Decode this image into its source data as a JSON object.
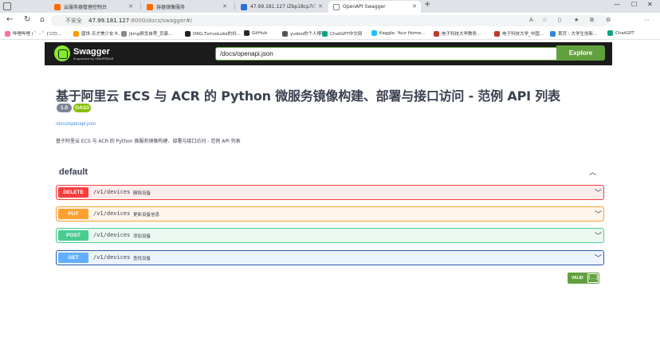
{
  "browser": {
    "tabs": [
      {
        "title": "云服务器管理控制台",
        "favicon_color": "#ff6a00",
        "active": false
      },
      {
        "title": "容器镜像服务",
        "favicon_color": "#ff6a00",
        "active": false
      },
      {
        "title": "47.99.181.127 iZbp18cp7r1h5ei0...",
        "favicon_color": "#2a6fdb",
        "active": false
      },
      {
        "title": "OpenAPI Swagger",
        "favicon_color": "#888888",
        "active": true
      }
    ],
    "new_tab_label": "+",
    "address": {
      "security_label": "不安全",
      "host": "47.99.181.127",
      "rest": ":8000/docs/swagger#/",
      "right_label": "A"
    },
    "bookmarks": [
      {
        "label": "哔哩哔哩 ( ゜- ゜)つロ...",
        "color": "#fb7299"
      },
      {
        "label": "盛世-天才美少女卡...",
        "color": "#ff9800"
      },
      {
        "label": "jking倒戈自荐_页康...",
        "color": "#888888"
      },
      {
        "label": "DRG.TvirusLuke的抖...",
        "color": "#222222"
      },
      {
        "label": "GitHub",
        "color": "#24292e"
      },
      {
        "label": "yudoo的个人博客",
        "color": "#555555"
      },
      {
        "label": "ChatGPT中文网",
        "color": "#10a37f"
      },
      {
        "label": "Kaggle: Your Home...",
        "color": "#20beff"
      },
      {
        "label": "电子科技大学教务...",
        "color": "#c0392b"
      },
      {
        "label": "电子科技大学_中国...",
        "color": "#c0392b"
      },
      {
        "label": "首页 - 大学生创新...",
        "color": "#2e86de"
      },
      {
        "label": "ChatGPT",
        "color": "#10a37f"
      }
    ]
  },
  "swagger": {
    "brand_name": "Swagger",
    "brand_sub": "Supported by SMARTBEAR",
    "spec_url": "/docs/openapi.json",
    "explore_label": "Explore",
    "title": "基于阿里云 ECS 与 ACR 的 Python 微服务镜像构建、部署与接口访问 - 范例 API 列表",
    "version_badge": "1.0",
    "oas_badge": "OAS3",
    "spec_link": "/docs/openapi.json",
    "description": "基于阿里云 ECS 与 ACR 的 Python 微服务镜像构建、部署与接口访问 - 范例 API 列表",
    "tag": "default",
    "operations": [
      {
        "method": "DELETE",
        "path": "/v1/devices",
        "summary": "删除设备",
        "color": "#f93e3e",
        "bg": "#fdecec"
      },
      {
        "method": "PUT",
        "path": "/v1/devices",
        "summary": "更新设备信息",
        "color": "#fca130",
        "bg": "#fff5ea"
      },
      {
        "method": "POST",
        "path": "/v1/devices",
        "summary": "添加设备",
        "color": "#49cc90",
        "bg": "#eaf8f1"
      },
      {
        "method": "GET",
        "path": "/v1/devices",
        "summary": "查找设备",
        "color": "#61affe",
        "bg": "#ebf3fb"
      }
    ],
    "validator_label": "VALID",
    "validator_icon": "{...}"
  }
}
